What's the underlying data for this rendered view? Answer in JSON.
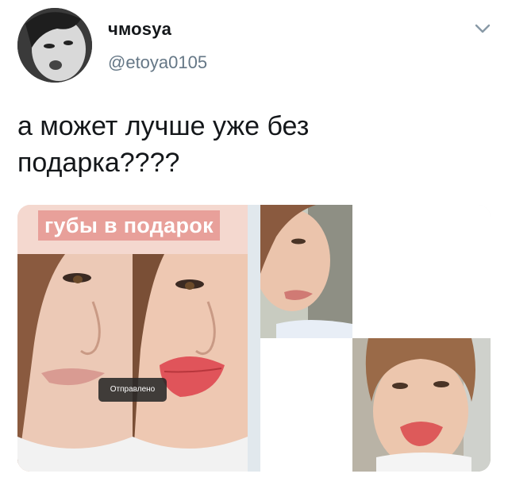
{
  "user": {
    "display_name": "чмоsya",
    "handle": "@etoya0105"
  },
  "menu": {
    "icon": "chevron-down-icon"
  },
  "tweet": {
    "text_line1": "а может лучше уже без",
    "text_line2": "подарка????"
  },
  "media": {
    "left_banner": "губы в подарок",
    "toast": "Отправлено"
  },
  "colors": {
    "text": "#14171a",
    "secondary": "#657786",
    "banner_bg": "#e8a09a"
  }
}
